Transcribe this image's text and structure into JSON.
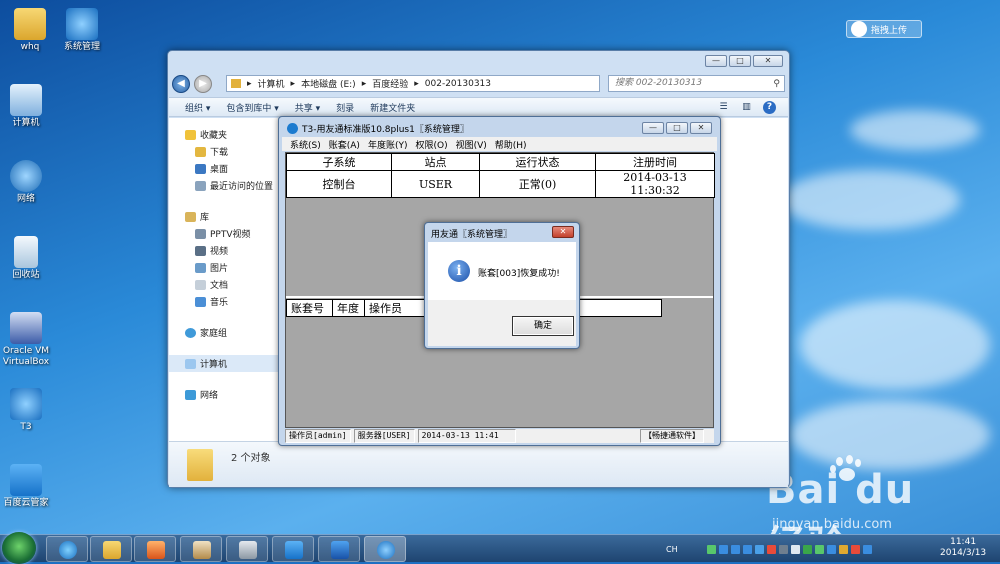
{
  "desktop": {
    "icons": [
      {
        "label": "whq",
        "color": "#e8b840"
      },
      {
        "label": "系统管理",
        "color": "#2a8ad8"
      },
      {
        "label": "计算机",
        "color": "#9cc7ef"
      },
      {
        "label": "网络",
        "color": "#3d9ad8"
      },
      {
        "label": "回收站",
        "color": "#cfe3f3"
      },
      {
        "label": "Oracle VM VirtualBox",
        "color": "#6b8fd1"
      },
      {
        "label": "T3",
        "color": "#2a8ad8"
      },
      {
        "label": "百度云管家",
        "color": "#1e86df"
      }
    ],
    "upload_button": "拖拽上传"
  },
  "explorer": {
    "address_segments": [
      "计算机",
      "本地磁盘 (E:)",
      "百度经验",
      "002-20130313"
    ],
    "search_placeholder": "搜索 002-20130313",
    "toolbar": [
      "组织 ▾",
      "包含到库中 ▾",
      "共享 ▾",
      "刻录",
      "新建文件夹"
    ],
    "sidebar": {
      "favorites": "收藏夹",
      "favorites_items": [
        "下载",
        "桌面",
        "最近访问的位置"
      ],
      "libraries": "库",
      "libraries_items": [
        "PPTV视频",
        "视频",
        "图片",
        "文档",
        "音乐"
      ],
      "homegroup": "家庭组",
      "computer": "计算机",
      "network": "网络"
    },
    "item_count": "2 个对象"
  },
  "t3": {
    "title": "T3-用友通标准版10.8plus1〖系统管理〗",
    "menu": [
      "系统(S)",
      "账套(A)",
      "年度账(Y)",
      "权限(O)",
      "视图(V)",
      "帮助(H)"
    ],
    "table_headers": [
      "子系统",
      "站点",
      "运行状态",
      "注册时间"
    ],
    "table_row": [
      "控制台",
      "USER",
      "正常(0)",
      "2014-03-13 11:30:32"
    ],
    "acc_headers": [
      "账套号",
      "年度",
      "操作员"
    ],
    "status": [
      "操作员[admin]",
      "服务器[USER]",
      "2014-03-13 11:41",
      "【畅捷通软件】"
    ]
  },
  "dialog": {
    "title": "用友通〖系统管理〗",
    "message": "账套[003]恢复成功!",
    "ok": "确定",
    "close": "✕"
  },
  "taskbar": {
    "lang": "CH",
    "time": "11:41",
    "date": "2014/3/13"
  },
  "watermark": {
    "brand": "Bai du 经验",
    "url": "jingyan.baidu.com"
  }
}
